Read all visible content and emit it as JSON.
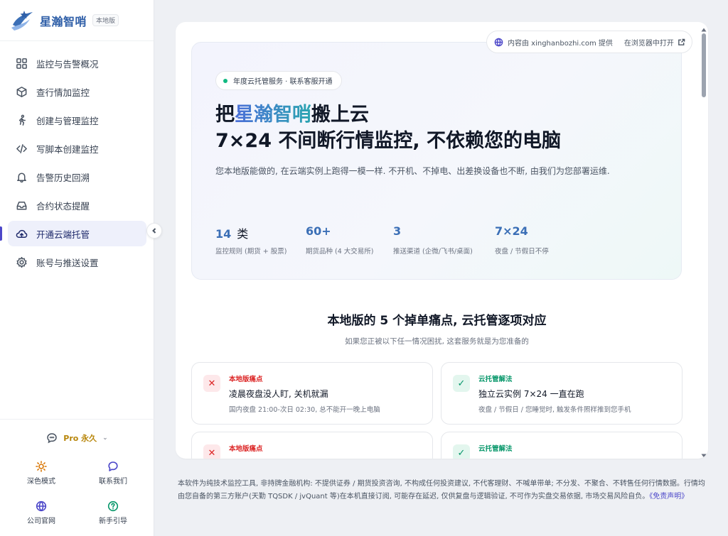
{
  "brand": {
    "name": "星瀚智哨",
    "badge": "本地版"
  },
  "nav": {
    "items": [
      {
        "label": "监控与告警概况",
        "icon": "dashboard-icon"
      },
      {
        "label": "查行情加监控",
        "icon": "cube-icon"
      },
      {
        "label": "创建与管理监控",
        "icon": "runner-icon"
      },
      {
        "label": "写脚本创建监控",
        "icon": "code-icon"
      },
      {
        "label": "告警历史回溯",
        "icon": "bell-icon"
      },
      {
        "label": "合约状态提醒",
        "icon": "inbox-icon"
      },
      {
        "label": "开通云端托管",
        "icon": "cloud-upload-icon",
        "active": true
      },
      {
        "label": "账号与推送设置",
        "icon": "gear-icon"
      }
    ]
  },
  "sidebar_bottom": {
    "plan_label": "Pro 永久",
    "quick": [
      {
        "label": "深色模式",
        "icon": "sun-icon"
      },
      {
        "label": "联系我们",
        "icon": "chat-bubble-icon"
      },
      {
        "label": "公司官网",
        "icon": "globe-icon"
      },
      {
        "label": "新手引导",
        "icon": "help-circle-icon"
      }
    ]
  },
  "source_bar": {
    "provider_text": "内容由 xinghanbozhi.com 提供",
    "open_label": "在浏览器中打开"
  },
  "hero": {
    "pill": "年度云托管服务 · 联系客服开通",
    "title_prefix": "把",
    "title_accent": "星瀚智哨",
    "title_suffix": "搬上云",
    "title_line2": "7×24 不间断行情监控, 不依赖您的电脑",
    "description": "您本地版能做的, 在云端实例上跑得一模一样. 不开机、不掉电、出差换设备也不断, 由我们为您部署运维.",
    "stats": [
      {
        "value": "14",
        "unit": "类",
        "label": "监控规则 (期货 + 股票)"
      },
      {
        "value": "60+",
        "unit": "",
        "label": "期货品种 (4 大交易所)"
      },
      {
        "value": "3",
        "unit": "",
        "label": "推送渠道 (企微/飞书/桌面)"
      },
      {
        "value": "7×24",
        "unit": "",
        "label": "夜盘 / 节假日不停"
      }
    ]
  },
  "section": {
    "title": "本地版的 5 个掉单痛点, 云托管逐项对应",
    "subtitle": "如果您正被以下任一情况困扰, 这套服务就是为您准备的"
  },
  "cards": [
    {
      "kind": "pain",
      "mark": "✕",
      "tag": "本地版痛点",
      "title": "凌晨夜盘没人盯, 关机就漏",
      "desc": "国内夜盘 21:00-次日 02:30, 总不能开一晚上电脑"
    },
    {
      "kind": "sol",
      "mark": "✓",
      "tag": "云托管解法",
      "title": "独立云实例 7×24 一直在跑",
      "desc": "夜盘 / 节假日 / 您睡觉时, 触发条件照样推到您手机"
    },
    {
      "kind": "pain",
      "mark": "✕",
      "tag": "本地版痛点",
      "title": "",
      "desc": ""
    },
    {
      "kind": "sol",
      "mark": "✓",
      "tag": "云托管解法",
      "title": "",
      "desc": ""
    }
  ],
  "footer": {
    "text": "本软件为纯技术监控工具, 非持牌金融机构: 不提供证券 / 期货投资咨询, 不构成任何投资建议, 不代客理财、不喊单带单; 不分发、不聚合、不转售任何行情数据。行情均由您自备的第三方账户(天勤 TQSDK / jvQuant 等)在本机直接订阅, 可能存在延迟, 仅供复盘与逻辑验证, 不可作为实盘交易依据, 市场交易风险自负。",
    "link": "《免责声明》"
  },
  "colors": {
    "accent": "#4c47c9",
    "brand": "#2f5fa8",
    "pain": "#dc2626",
    "solution": "#059669",
    "pro": "#b8860b"
  }
}
